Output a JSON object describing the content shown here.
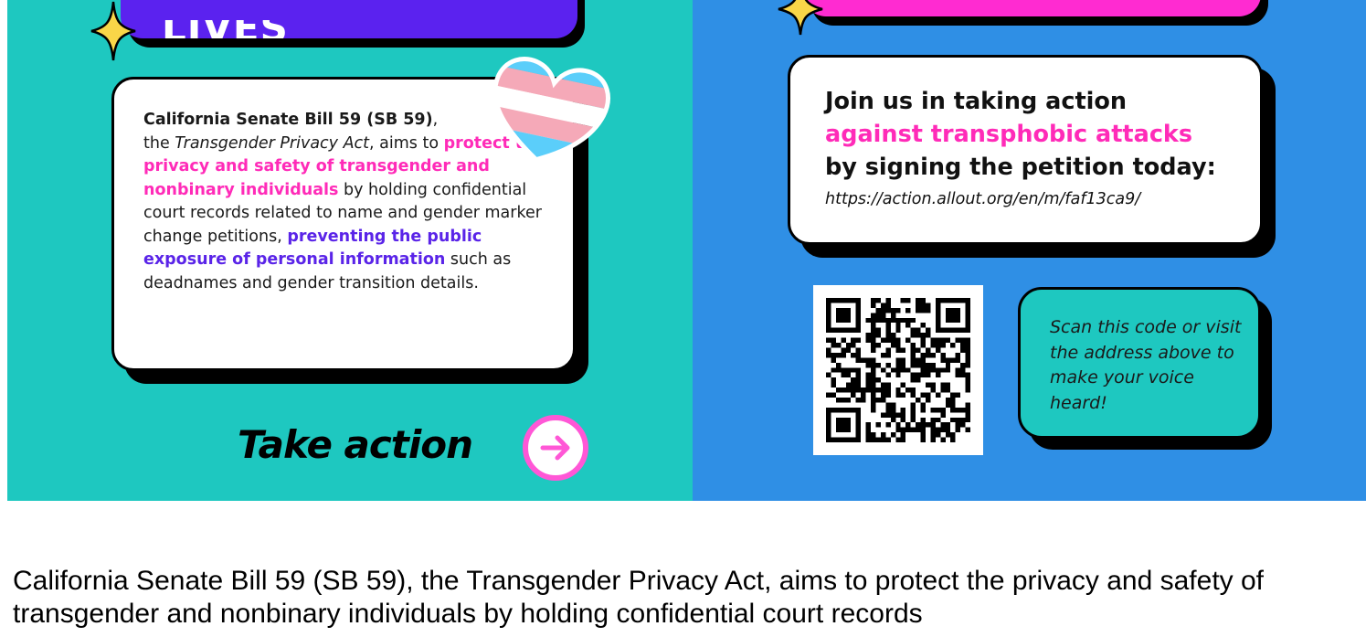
{
  "poster": {
    "left_banner_text": "LIVES",
    "sb59_card": {
      "bill_name": "California Senate Bill 59 (SB 59)",
      "sep1": ",",
      "text1": "the ",
      "act_name": "Transgender Privacy Act",
      "text2": ", aims to ",
      "pink_phrase": "protect the privacy and safety of transgender and nonbinary individuals",
      "text3": " by holding confidential court records related to name and gender marker change petitions, ",
      "purple_phrase": "preventing the public exposure of personal information",
      "text4": " such as deadnames and gender transition details."
    },
    "take_action_label": "Take action",
    "join_card": {
      "line1": "Join us in taking action",
      "line2": "against transphobic attacks",
      "line3": "by signing the petition today:",
      "url": "https://action.allout.org/en/m/faf13ca9/"
    },
    "scan_card_text": "Scan this code or visit the address above to make your voice heard!",
    "colors": {
      "teal": "#1ec8c0",
      "blue": "#2f8fe5",
      "purple": "#5b22ef",
      "pink": "#ff2bd1",
      "sparkle": "#f9d648"
    }
  },
  "caption": "California Senate Bill 59 (SB 59), the Transgender Privacy Act, aims to protect the privacy and safety of transgender and nonbinary individuals by holding confidential court records"
}
